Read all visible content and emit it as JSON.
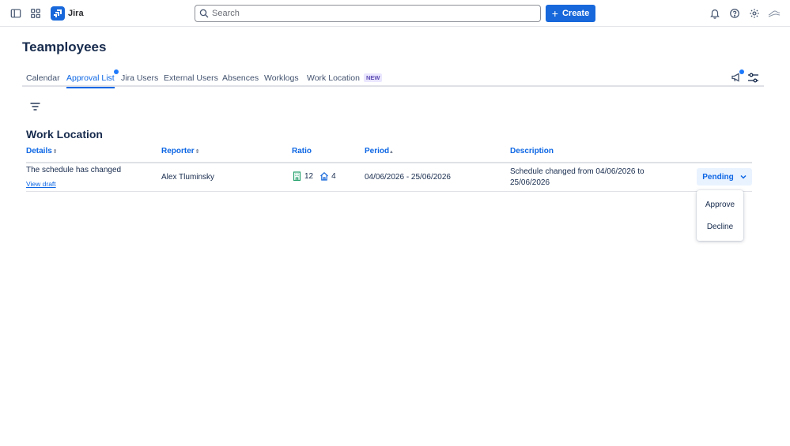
{
  "topbar": {
    "app_name": "Jira",
    "search_placeholder": "Search",
    "create_label": "Create",
    "icons": [
      "sidebar-toggle-icon",
      "app-switcher-icon",
      "jira-logo-icon",
      "bell-icon",
      "help-icon",
      "gear-icon",
      "avatar-icon"
    ]
  },
  "page": {
    "title": "Teamployees"
  },
  "tabs": [
    {
      "label": "Calendar"
    },
    {
      "label": "Approval List",
      "active": true
    },
    {
      "label": "Jira Users"
    },
    {
      "label": "External Users"
    },
    {
      "label": "Absences"
    },
    {
      "label": "Worklogs"
    },
    {
      "label": "Work Location",
      "badge": "NEW"
    }
  ],
  "section": {
    "title": "Work Location"
  },
  "table": {
    "columns": [
      {
        "label": "Details",
        "sortable": true
      },
      {
        "label": "Reporter",
        "sortable": true
      },
      {
        "label": "Ratio",
        "sortable": false
      },
      {
        "label": "Period",
        "sortable": true
      },
      {
        "label": "Description",
        "sortable": false
      }
    ],
    "rows": [
      {
        "details": "The schedule has changed",
        "details_link": "View draft",
        "reporter": "Alex Tluminsky",
        "ratio_office": "12",
        "ratio_home": "4",
        "period": "04/06/2026 - 25/06/2026",
        "description_line1": "Schedule changed from 04/06/2026 to",
        "description_line2": "25/06/2026",
        "status": "Pending"
      }
    ]
  },
  "status_menu": {
    "items": [
      "Approve",
      "Decline"
    ]
  },
  "colors": {
    "brand": "#1868db",
    "link": "#0c66e4",
    "text": "#172b4d",
    "pending_bg": "#e9f2ff",
    "badge_bg": "#eae6ff",
    "badge_text": "#5e4db2",
    "office_icon": "#22a06b"
  }
}
